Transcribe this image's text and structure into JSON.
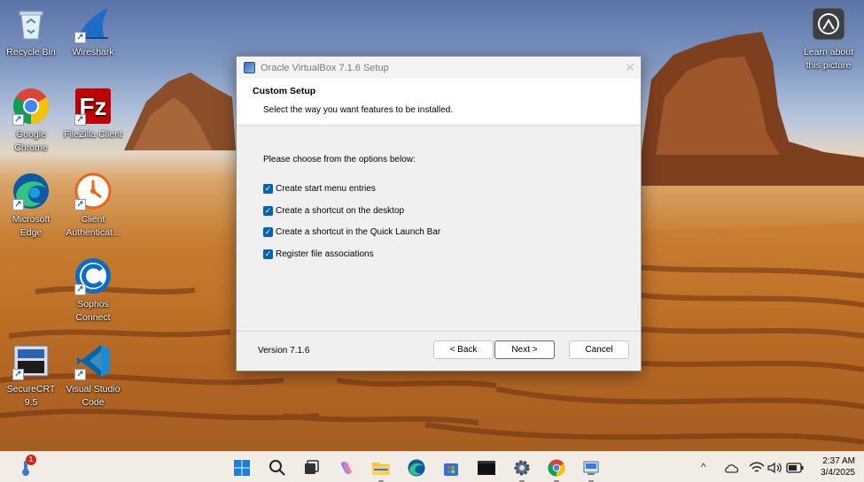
{
  "desktop": {
    "icons": [
      {
        "label_1": "Recycle Bin",
        "label_2": ""
      },
      {
        "label_1": "Wireshark",
        "label_2": ""
      },
      {
        "label_1": "Google",
        "label_2": "Chrome"
      },
      {
        "label_1": "FileZilla Client",
        "label_2": ""
      },
      {
        "label_1": "Microsoft",
        "label_2": "Edge"
      },
      {
        "label_1": "Client",
        "label_2": "Authenticat..."
      },
      {
        "label_1": "Sophos",
        "label_2": "Connect"
      },
      {
        "label_1": "SecureCRT 9.5",
        "label_2": ""
      },
      {
        "label_1": "Visual Studio",
        "label_2": "Code"
      }
    ],
    "spotlight": {
      "label_1": "Learn about",
      "label_2": "this picture"
    }
  },
  "dialog": {
    "title": "Oracle VirtualBox 7.1.6 Setup",
    "header_title": "Custom Setup",
    "header_subtitle": "Select the way you want features to be installed.",
    "prompt": "Please choose from the options below:",
    "options": [
      {
        "label": "Create start menu entries",
        "checked": true
      },
      {
        "label": "Create a shortcut on the desktop",
        "checked": true
      },
      {
        "label": "Create a shortcut in the Quick Launch Bar",
        "checked": true
      },
      {
        "label": "Register file associations",
        "checked": true
      }
    ],
    "version": "Version 7.1.6",
    "buttons": {
      "back": "< Back",
      "next": "Next >",
      "cancel": "Cancel"
    }
  },
  "taskbar": {
    "weather_badge": "1",
    "clock_time": "2:37 AM",
    "clock_date": "3/4/2025",
    "tray_chevron": "^"
  },
  "colors": {
    "accent": "#0063b1",
    "checkbox": "#0063b1"
  }
}
